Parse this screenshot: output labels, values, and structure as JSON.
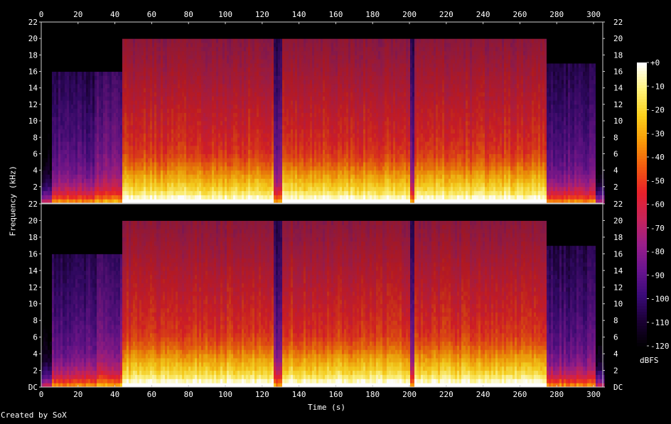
{
  "chart_data": {
    "type": "heatmap",
    "chart_kind": "spectrogram",
    "xlabel": "Time (s)",
    "ylabel": "Frequency (kHz)",
    "colorbar_label": "dBFS",
    "credit": "Created by SoX",
    "xlim": [
      0,
      305
    ],
    "x_ticks": [
      0,
      20,
      40,
      60,
      80,
      100,
      120,
      140,
      160,
      180,
      200,
      220,
      240,
      260,
      280,
      300
    ],
    "ylim": [
      0,
      22
    ],
    "y_ticks": [
      "DC",
      "2",
      "4",
      "6",
      "8",
      "10",
      "12",
      "14",
      "16",
      "18",
      "20",
      "22"
    ],
    "colorbar_ticks": [
      "+0",
      "-10",
      "-20",
      "-30",
      "-40",
      "-50",
      "-60",
      "-70",
      "-80",
      "-90",
      "-100",
      "-110",
      "-120"
    ],
    "colorbar_range": [
      -120,
      0
    ],
    "channels": 2,
    "segments": [
      {
        "start": 0,
        "end": 5,
        "level_db": -115
      },
      {
        "start": 5,
        "end": 30,
        "level_db": -85,
        "cutoff_khz": 16
      },
      {
        "start": 30,
        "end": 43,
        "level_db": -78,
        "cutoff_khz": 16
      },
      {
        "start": 43,
        "end": 126,
        "level_db": -45,
        "cutoff_khz": 20
      },
      {
        "start": 126,
        "end": 130,
        "level_db": -80,
        "cutoff_khz": 20
      },
      {
        "start": 130,
        "end": 200,
        "level_db": -45,
        "cutoff_khz": 20
      },
      {
        "start": 200,
        "end": 202,
        "level_db": -80,
        "cutoff_khz": 20
      },
      {
        "start": 202,
        "end": 274,
        "level_db": -45,
        "cutoff_khz": 20
      },
      {
        "start": 274,
        "end": 300,
        "level_db": -85,
        "cutoff_khz": 17
      },
      {
        "start": 300,
        "end": 305,
        "level_db": -120
      }
    ],
    "colors": {
      "palette": [
        "#000000",
        "#1a0033",
        "#3a0a78",
        "#6a1490",
        "#9a1e8a",
        "#c8245a",
        "#e8202a",
        "#f25a10",
        "#f89a08",
        "#fbd01c",
        "#fff27a",
        "#ffffff"
      ],
      "axis": "#d0d0d0",
      "background": "#000000"
    }
  }
}
